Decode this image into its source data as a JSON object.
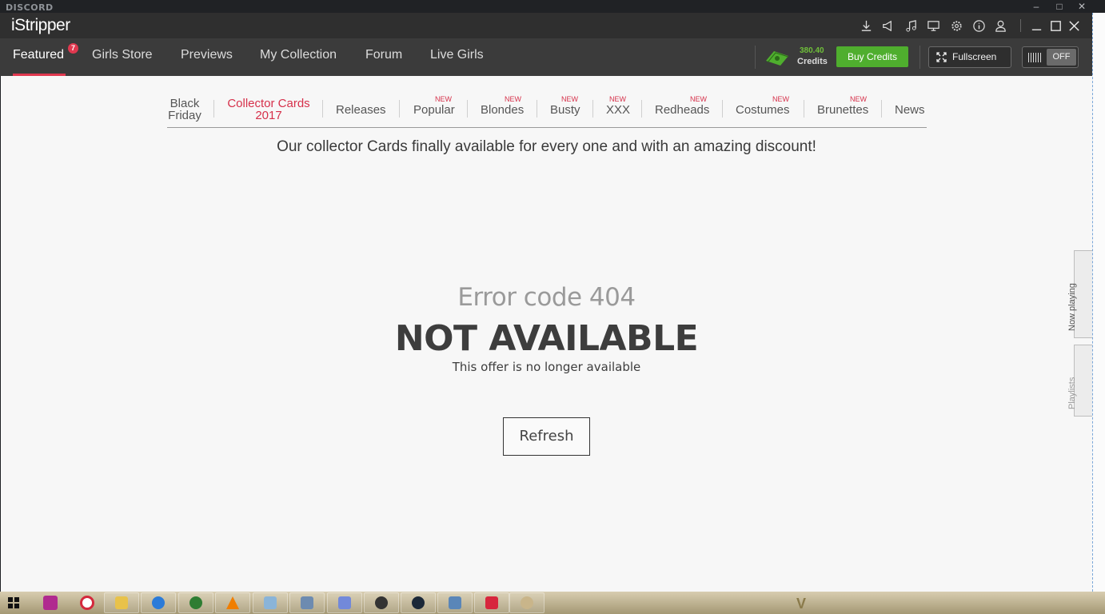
{
  "discord": {
    "logo": "DISCORD"
  },
  "app": {
    "name": "iStripper"
  },
  "nav": {
    "items": [
      {
        "label": "Featured",
        "badge": "7",
        "active": true
      },
      {
        "label": "Girls Store"
      },
      {
        "label": "Previews"
      },
      {
        "label": "My Collection"
      },
      {
        "label": "Forum"
      },
      {
        "label": "Live Girls"
      }
    ],
    "credits_amount": "380.40",
    "credits_label": "Credits",
    "buy_credits": "Buy Credits",
    "fullscreen": "Fullscreen",
    "toggle_state": "OFF"
  },
  "subnav": {
    "items": [
      {
        "line1": "Black",
        "line2": "Friday"
      },
      {
        "line1": "Collector Cards",
        "line2": "2017",
        "active": true
      },
      {
        "label": "Releases"
      },
      {
        "label": "Popular",
        "new": "NEW"
      },
      {
        "label": "Blondes",
        "new": "NEW"
      },
      {
        "label": "Busty",
        "new": "NEW"
      },
      {
        "label": "XXX",
        "new": "NEW"
      },
      {
        "label": "Redheads",
        "new": "NEW"
      },
      {
        "label": "Costumes",
        "new": "NEW"
      },
      {
        "label": "Brunettes",
        "new": "NEW"
      },
      {
        "label": "News"
      }
    ]
  },
  "banner": "Our collector Cards finally available for every one and with an amazing discount!",
  "error": {
    "code": "Error code 404",
    "title": "NOT AVAILABLE",
    "message": "This offer is no longer available",
    "refresh": "Refresh"
  },
  "side_tabs": {
    "now_playing": "Now playing",
    "playlists": "Playlists"
  },
  "colors": {
    "accent": "#e0384f",
    "green": "#4fae2e",
    "nav_bg": "#3b3b3b",
    "content_bg": "#f7f7f7"
  },
  "taskbar": {
    "icons": [
      "windows-start-icon",
      "camera-app-icon",
      "alarm-icon",
      "file-explorer-icon",
      "internet-explorer-icon",
      "grid-app-icon",
      "vlc-icon",
      "notepad-icon",
      "calculator-icon",
      "discord-icon",
      "origin-icon",
      "steam-icon",
      "cloud-app-icon",
      "istripper-icon",
      "paint-icon"
    ]
  }
}
